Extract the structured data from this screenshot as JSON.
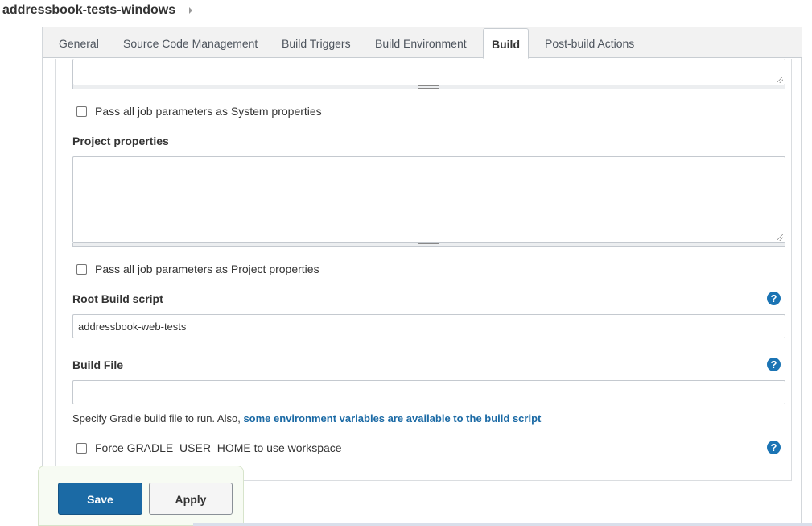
{
  "header": {
    "job_title": "addressbook-tests-windows"
  },
  "tabs": [
    {
      "label": "General",
      "active": false
    },
    {
      "label": "Source Code Management",
      "active": false
    },
    {
      "label": "Build Triggers",
      "active": false
    },
    {
      "label": "Build Environment",
      "active": false
    },
    {
      "label": "Build",
      "active": true
    },
    {
      "label": "Post-build Actions",
      "active": false
    }
  ],
  "form": {
    "system_properties_value": "",
    "pass_system_props": {
      "label": "Pass all job parameters as System properties",
      "checked": false
    },
    "project_properties": {
      "label": "Project properties",
      "value": ""
    },
    "pass_project_props": {
      "label": "Pass all job parameters as Project properties",
      "checked": false
    },
    "root_build_script": {
      "label": "Root Build script",
      "value": "addressbook-web-tests"
    },
    "build_file": {
      "label": "Build File",
      "value": "",
      "hint_text": "Specify Gradle build file to run. Also, ",
      "hint_link": "some environment variables are available to the build script"
    },
    "force_gradle_home": {
      "label": "Force GRADLE_USER_HOME to use workspace",
      "checked": false
    }
  },
  "help_icon_glyph": "?",
  "actions": {
    "save_label": "Save",
    "apply_label": "Apply"
  },
  "colors": {
    "accent": "#1b6aa5",
    "help_icon": "#1b74b4",
    "tab_bar": "#f2f2f2",
    "bottom_bar": "#f7fbf3"
  },
  "icons": {
    "breadcrumb_caret": "chevron-right-icon",
    "help": "help-icon"
  }
}
